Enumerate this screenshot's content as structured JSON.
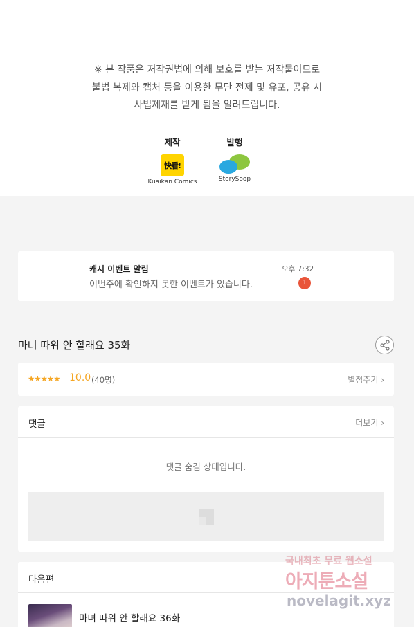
{
  "copyright": {
    "lines": [
      "※ 본 작품은 저작권법에 의해 보호를 받는 저작물이므로",
      "불법 복제와 캡처 등을 이용한 무단 전제 및 유포, 공유 시",
      "사법제재를 받게 됨을 알려드립니다."
    ],
    "maker_label": "제작",
    "maker_logo_text": "快看!",
    "maker_name": "Kuaikan Comics",
    "publisher_label": "발행",
    "publisher_name": "StorySoop"
  },
  "notification": {
    "title": "캐시 이벤트 알림",
    "message": "이번주에 확인하지 못한 이벤트가 있습니다.",
    "time": "오후 7:32",
    "badge": "1"
  },
  "episode": {
    "title": "마녀 따위 안 할래요 35화"
  },
  "rating": {
    "stars": "★★★★★",
    "score": "10.0",
    "count": "(40명)",
    "action": "별점주기 ›"
  },
  "comments": {
    "title": "댓글",
    "more": "더보기 ›",
    "hidden_message": "댓글 숨김 상태입니다."
  },
  "next": {
    "title": "다음편",
    "episode": "마녀 따위 안 할래요 36화"
  },
  "watermark": {
    "line1": "국내최초 무료 웹소설",
    "line2": "아지툰소설",
    "line3": "novelagit.xyz"
  },
  "colors": {
    "accent_star": "#f5a623",
    "badge": "#e9553a",
    "kuaikan_yellow": "#ffd400"
  }
}
